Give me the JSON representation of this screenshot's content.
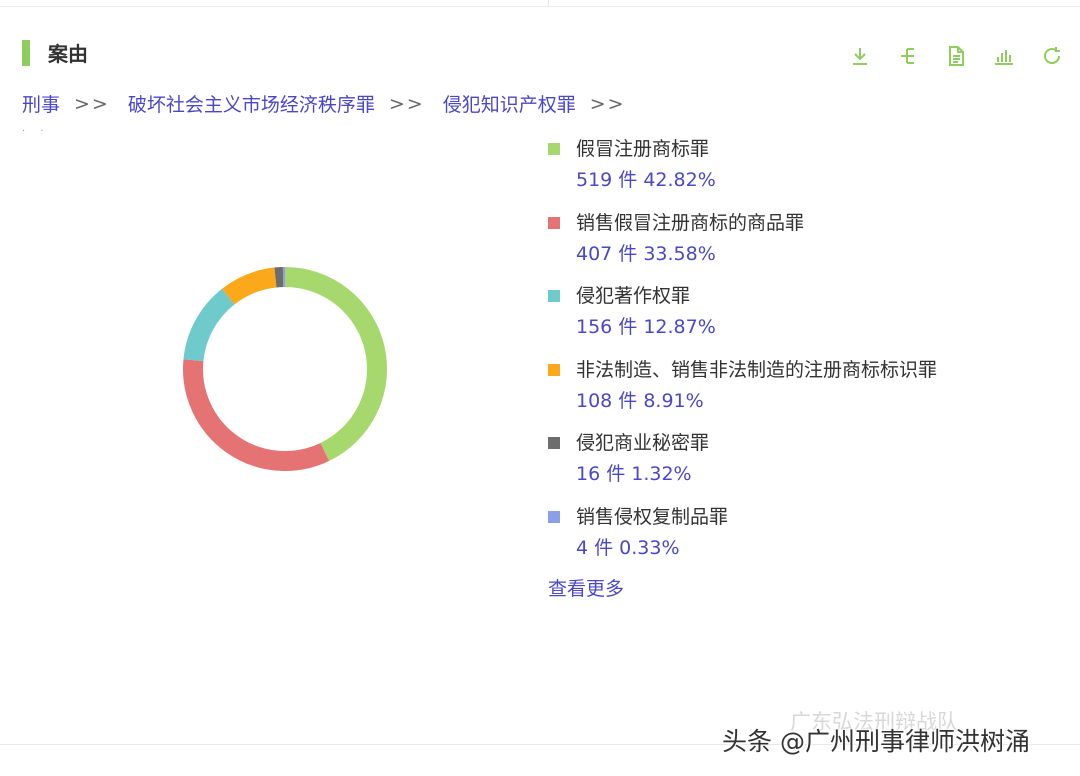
{
  "header": {
    "title": "案由",
    "accent_color": "#8fce5e",
    "toolbar": [
      {
        "icon": "download-icon"
      },
      {
        "icon": "tree-structure-icon"
      },
      {
        "icon": "document-icon"
      },
      {
        "icon": "bar-chart-icon"
      },
      {
        "icon": "refresh-icon"
      }
    ]
  },
  "breadcrumb": {
    "items": [
      "刑事",
      "破坏社会主义市场经济秩序罪",
      "侵犯知识产权罪"
    ],
    "separator": ">>"
  },
  "stray_text": "· ·",
  "chart_data": {
    "type": "pie",
    "donut": true,
    "labels": [
      "假冒注册商标罪",
      "销售假冒注册商标的商品罪",
      "侵犯著作权罪",
      "非法制造、销售非法制造的注册商标标识罪",
      "侵犯商业秘密罪",
      "销售侵权复制品罪"
    ],
    "values": [
      519,
      407,
      156,
      108,
      16,
      4
    ],
    "value_unit": "件",
    "percents": [
      "42.82%",
      "33.58%",
      "12.87%",
      "8.91%",
      "1.32%",
      "0.33%"
    ],
    "colors": [
      "#a6d86e",
      "#e57373",
      "#6ecacb",
      "#fba81a",
      "#6d6d6d",
      "#8b9fe8"
    ],
    "legend_position": "right"
  },
  "legend": {
    "items": [
      {
        "name": "假冒注册商标罪",
        "value": "519 件  42.82%"
      },
      {
        "name": "销售假冒注册商标的商品罪",
        "value": "407 件  33.58%"
      },
      {
        "name": "侵犯著作权罪",
        "value": "156 件  12.87%"
      },
      {
        "name": "非法制造、销售非法制造的注册商标标识罪",
        "value": "108 件  8.91%"
      },
      {
        "name": "侵犯商业秘密罪",
        "value": "16 件  1.32%"
      },
      {
        "name": "销售侵权复制品罪",
        "value": "4 件  0.33%"
      }
    ],
    "more_label": "查看更多"
  },
  "watermark": {
    "text": "头条 @广州刑事律师洪树涌",
    "faint_text": "广东弘法刑辩战队"
  }
}
